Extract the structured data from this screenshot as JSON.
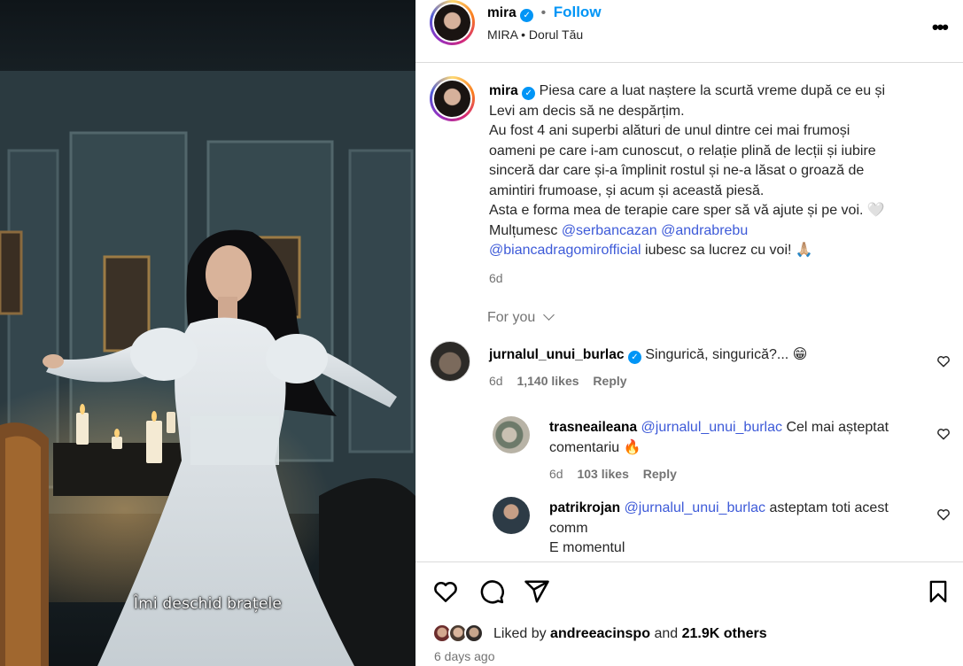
{
  "media": {
    "subtitle": "Îmi deschid brațele"
  },
  "post_header": {
    "username": "mira",
    "separator": "•",
    "follow_label": "Follow",
    "audio_artist": "MIRA",
    "audio_separator": "•",
    "audio_title": "Dorul Tău",
    "more_icon": "more-horizontal-icon"
  },
  "caption": {
    "username": "mira",
    "lines": [
      "Piesa care a luat naștere la scurtă vreme după ce eu și",
      "Levi am decis să ne despărțim.",
      "Au fost 4 ani superbi alături de unul dintre cei mai frumoși",
      "oameni pe care i-am cunoscut, o relație plină de lecții și iubire",
      "sinceră dar care și-a împlinit rostul și ne-a lăsat o groază de",
      "amintiri frumoase, și acum și această piesă.",
      "Asta e forma mea de terapie care sper să vă ajute și pe voi. 🤍"
    ],
    "thanks_prefix": "Mulțumesc",
    "mention_1": "@serbancazan",
    "mention_2": "@andrabrebu",
    "mention_3": "@biancadragomirofficial",
    "thanks_suffix": "iubesc sa lucrez cu voi! 🙏🏼",
    "time": "6d"
  },
  "for_you": {
    "label": "For you"
  },
  "comments": [
    {
      "username": "jurnalul_unui_burlac",
      "verified": true,
      "text": "Singurică, singurică?... 😁",
      "time": "6d",
      "likes": "1,140 likes",
      "reply_label": "Reply"
    },
    {
      "username": "trasneaileana",
      "mention": "@jurnalul_unui_burlac",
      "text_line1": "Cel mai așteptat",
      "text_line2": "comentariu 🔥",
      "time": "6d",
      "likes": "103 likes",
      "reply_label": "Reply"
    },
    {
      "username": "patrikrojan",
      "mention": "@jurnalul_unui_burlac",
      "text_line1": "asteptam toti acest",
      "text_line2": "comm",
      "text_line3": "E momentul"
    }
  ],
  "footer": {
    "liked_prefix": "Liked by",
    "liked_user": "andreeacinspo",
    "liked_and": "and",
    "liked_others": "21.9K others",
    "posted_ago": "6 days ago"
  },
  "colors": {
    "link": "#0095f6",
    "mention": "#3d5ad8",
    "muted": "#737373",
    "divider": "#dbdbdb"
  }
}
